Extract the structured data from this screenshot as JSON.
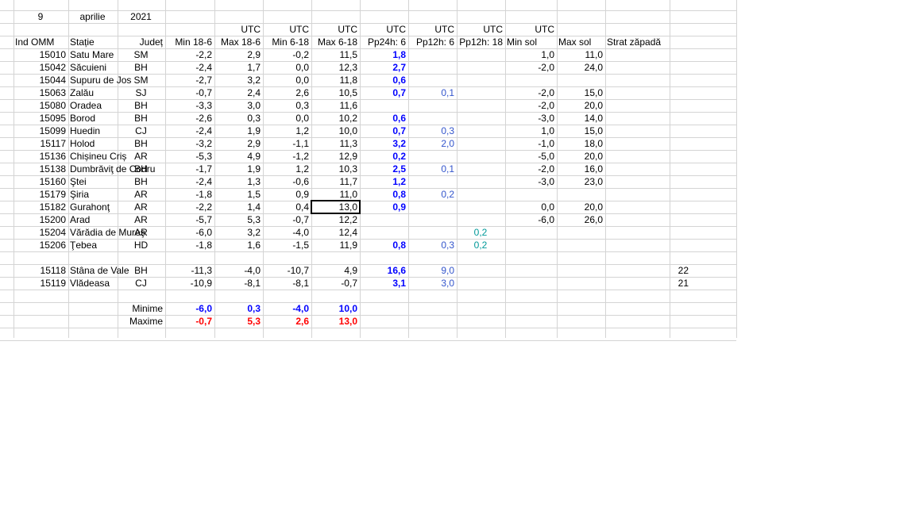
{
  "header": {
    "day": "9",
    "month": "aprilie",
    "year": "2021",
    "utc": [
      "UTC",
      "UTC",
      "UTC",
      "UTC",
      "UTC",
      "UTC",
      "UTC"
    ],
    "columns": [
      "Ind OMM",
      "Stație",
      "Județ",
      "Min 18-6",
      "Max 18-6",
      "Min 6-18",
      "Max 6-18",
      "Pp24h: 6",
      "Pp12h: 6",
      "Pp12h: 18",
      "Min sol",
      "Max sol",
      "Strat zăpadă"
    ]
  },
  "rows": [
    {
      "omm": "15010",
      "statie": "Satu Mare",
      "judet": "SM",
      "min186": "-2,2",
      "max186": "2,9",
      "min618": "-0,2",
      "max618": "11,5",
      "pp24": "1,8",
      "pp12a": "",
      "pp12b": "",
      "minsol": "1,0",
      "maxsol": "11,0",
      "zapada": ""
    },
    {
      "omm": "15042",
      "statie": "Săcuieni",
      "judet": "BH",
      "min186": "-2,4",
      "max186": "1,7",
      "min618": "0,0",
      "max618": "12,3",
      "pp24": "2,7",
      "pp12a": "",
      "pp12b": "",
      "minsol": "-2,0",
      "maxsol": "24,0",
      "zapada": ""
    },
    {
      "omm": "15044",
      "statie": "Supuru de Jos",
      "judet": "SM",
      "min186": "-2,7",
      "max186": "3,2",
      "min618": "0,0",
      "max618": "11,8",
      "pp24": "0,6",
      "pp12a": "",
      "pp12b": "",
      "minsol": "",
      "maxsol": "",
      "zapada": ""
    },
    {
      "omm": "15063",
      "statie": "Zalău",
      "judet": "SJ",
      "min186": "-0,7",
      "max186": "2,4",
      "min618": "2,6",
      "max618": "10,5",
      "pp24": "0,7",
      "pp12a": "0,1",
      "pp12b": "",
      "minsol": "-2,0",
      "maxsol": "15,0",
      "zapada": ""
    },
    {
      "omm": "15080",
      "statie": "Oradea",
      "judet": "BH",
      "min186": "-3,3",
      "max186": "3,0",
      "min618": "0,3",
      "max618": "11,6",
      "pp24": "",
      "pp12a": "",
      "pp12b": "",
      "minsol": "-2,0",
      "maxsol": "20,0",
      "zapada": ""
    },
    {
      "omm": "15095",
      "statie": "Borod",
      "judet": "BH",
      "min186": "-2,6",
      "max186": "0,3",
      "min618": "0,0",
      "max618": "10,2",
      "pp24": "0,6",
      "pp12a": "",
      "pp12b": "",
      "minsol": "-3,0",
      "maxsol": "14,0",
      "zapada": ""
    },
    {
      "omm": "15099",
      "statie": "Huedin",
      "judet": "CJ",
      "min186": "-2,4",
      "max186": "1,9",
      "min618": "1,2",
      "max618": "10,0",
      "pp24": "0,7",
      "pp12a": "0,3",
      "pp12b": "",
      "minsol": "1,0",
      "maxsol": "15,0",
      "zapada": ""
    },
    {
      "omm": "15117",
      "statie": "Holod",
      "judet": "BH",
      "min186": "-3,2",
      "max186": "2,9",
      "min618": "-1,1",
      "max618": "11,3",
      "pp24": "3,2",
      "pp12a": "2,0",
      "pp12b": "",
      "minsol": "-1,0",
      "maxsol": "18,0",
      "zapada": ""
    },
    {
      "omm": "15136",
      "statie": "Chișineu   Criș",
      "judet": "AR",
      "min186": "-5,3",
      "max186": "4,9",
      "min618": "-1,2",
      "max618": "12,9",
      "pp24": "0,2",
      "pp12a": "",
      "pp12b": "",
      "minsol": "-5,0",
      "maxsol": "20,0",
      "zapada": ""
    },
    {
      "omm": "15138",
      "statie": "Dumbrăviţ  de Codru",
      "judet": "BH",
      "min186": "-1,7",
      "max186": "1,9",
      "min618": "1,2",
      "max618": "10,3",
      "pp24": "2,5",
      "pp12a": "0,1",
      "pp12b": "",
      "minsol": "-2,0",
      "maxsol": "16,0",
      "zapada": ""
    },
    {
      "omm": "15160",
      "statie": "Ştei",
      "judet": "BH",
      "min186": "-2,4",
      "max186": "1,3",
      "min618": "-0,6",
      "max618": "11,7",
      "pp24": "1,2",
      "pp12a": "",
      "pp12b": "",
      "minsol": "-3,0",
      "maxsol": "23,0",
      "zapada": ""
    },
    {
      "omm": "15179",
      "statie": "Şiria",
      "judet": "AR",
      "min186": "-1,8",
      "max186": "1,5",
      "min618": "0,9",
      "max618": "11,0",
      "pp24": "0,8",
      "pp12a": "0,2",
      "pp12b": "",
      "minsol": "",
      "maxsol": "",
      "zapada": ""
    },
    {
      "omm": "15182",
      "statie": "Gurahonţ",
      "judet": "AR",
      "min186": "-2,2",
      "max186": "1,4",
      "min618": "0,4",
      "max618": "13,0",
      "pp24": "0,9",
      "pp12a": "",
      "pp12b": "",
      "minsol": "0,0",
      "maxsol": "20,0",
      "zapada": ""
    },
    {
      "omm": "15200",
      "statie": "Arad",
      "judet": "AR",
      "min186": "-5,7",
      "max186": "5,3",
      "min618": "-0,7",
      "max618": "12,2",
      "pp24": "",
      "pp12a": "",
      "pp12b": "",
      "minsol": "-6,0",
      "maxsol": "26,0",
      "zapada": ""
    },
    {
      "omm": "15204",
      "statie": "Vărădia de Mureş",
      "judet": "AR",
      "min186": "-6,0",
      "max186": "3,2",
      "min618": "-4,0",
      "max618": "12,4",
      "pp24": "",
      "pp12a": "",
      "pp12b": "0,2",
      "minsol": "",
      "maxsol": "",
      "zapada": ""
    },
    {
      "omm": "15206",
      "statie": "Ţebea",
      "judet": "HD",
      "min186": "-1,8",
      "max186": "1,6",
      "min618": "-1,5",
      "max618": "11,9",
      "pp24": "0,8",
      "pp12a": "0,3",
      "pp12b": "0,2",
      "minsol": "",
      "maxsol": "",
      "zapada": ""
    },
    {
      "omm": "",
      "statie": "",
      "judet": "",
      "min186": "",
      "max186": "",
      "min618": "",
      "max618": "",
      "pp24": "",
      "pp12a": "",
      "pp12b": "",
      "minsol": "",
      "maxsol": "",
      "zapada": ""
    },
    {
      "omm": "15118",
      "statie": "Stâna de Vale",
      "judet": "BH",
      "min186": "-11,3",
      "max186": "-4,0",
      "min618": "-10,7",
      "max618": "4,9",
      "pp24": "16,6",
      "pp12a": "9,0",
      "pp12b": "",
      "minsol": "",
      "maxsol": "",
      "zapada": "22"
    },
    {
      "omm": "15119",
      "statie": "Vlădeasa",
      "judet": "CJ",
      "min186": "-10,9",
      "max186": "-8,1",
      "min618": "-8,1",
      "max618": "-0,7",
      "pp24": "3,1",
      "pp12a": "3,0",
      "pp12b": "",
      "minsol": "",
      "maxsol": "",
      "zapada": "21"
    }
  ],
  "summary": {
    "minime_label": "Minime",
    "maxime_label": "Maxime",
    "minime": [
      "-6,0",
      "0,3",
      "-4,0",
      "10,0"
    ],
    "maxime": [
      "-0,7",
      "5,3",
      "2,6",
      "13,0"
    ]
  },
  "colors": {
    "grid": "#d4d4d4",
    "blue": "#0000ff",
    "light_blue": "#3355cc",
    "teal": "#009999",
    "red": "#ff0000"
  }
}
